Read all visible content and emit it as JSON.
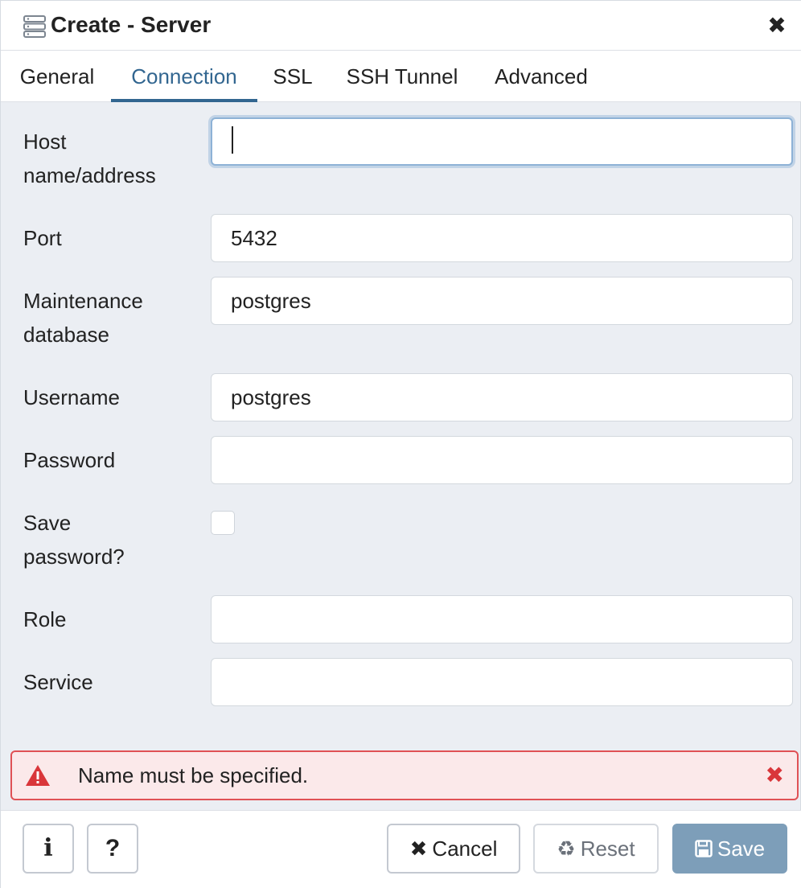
{
  "dialog": {
    "title": "Create - Server",
    "title_icon": "server-icon",
    "close_icon": "close-icon"
  },
  "tabs": [
    {
      "label": "General",
      "active": false
    },
    {
      "label": "Connection",
      "active": true
    },
    {
      "label": "SSL",
      "active": false
    },
    {
      "label": "SSH Tunnel",
      "active": false
    },
    {
      "label": "Advanced",
      "active": false
    }
  ],
  "form": {
    "host": {
      "line1": "Host",
      "line2": "name/address",
      "value": ""
    },
    "port": {
      "label": "Port",
      "value": "5432"
    },
    "maintenance_db": {
      "line1": "Maintenance",
      "line2": "database",
      "value": "postgres"
    },
    "username": {
      "label": "Username",
      "value": "postgres"
    },
    "password": {
      "label": "Password",
      "value": ""
    },
    "save_password": {
      "line1": "Save",
      "line2": "password?",
      "checked": false
    },
    "role": {
      "label": "Role",
      "value": ""
    },
    "service": {
      "label": "Service",
      "value": ""
    }
  },
  "error": {
    "message": "Name must be specified.",
    "icon": "warning-icon",
    "close_icon": "close-icon"
  },
  "footer": {
    "info_label": "i",
    "help_label": "?",
    "cancel_label": "Cancel",
    "cancel_glyph": "✖",
    "reset_label": "Reset",
    "reset_glyph": "♻",
    "save_label": "Save",
    "save_glyph": "🖫"
  },
  "colors": {
    "accent": "#326690",
    "error_border": "#e05155",
    "error_bg": "#fbe9ea",
    "save_bg": "#7d9eb9"
  }
}
